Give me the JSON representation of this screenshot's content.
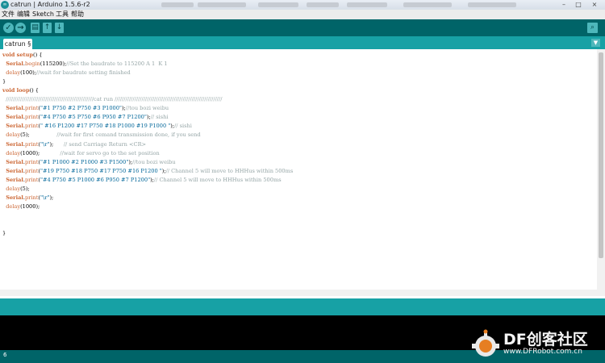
{
  "window": {
    "title": "catrun | Arduino 1.5.6-r2",
    "logo": "∞"
  },
  "menu": {
    "items": [
      "文件",
      "编辑",
      "Sketch",
      "工具",
      "帮助"
    ]
  },
  "toolbar": {
    "verify_icon": "✓",
    "upload_icon": "→",
    "new_icon": "▤",
    "open_icon": "↑",
    "save_icon": "↓",
    "serial_monitor_icon": "⌕"
  },
  "tabs": {
    "active_label": "catrun §",
    "menu_icon": "▼"
  },
  "code": {
    "lines": [
      [
        {
          "t": "void ",
          "c": "kw"
        },
        {
          "t": "setup",
          "c": "kw"
        },
        {
          "t": "() {",
          "c": ""
        }
      ],
      [
        {
          "t": "  ",
          "c": ""
        },
        {
          "t": "Serial",
          "c": "cl"
        },
        {
          "t": ".",
          "c": ""
        },
        {
          "t": "begin",
          "c": "fn"
        },
        {
          "t": "(115200);",
          "c": ""
        },
        {
          "t": "//Set the baudrate to 115200 A 1  K 1",
          "c": "cm"
        }
      ],
      [
        {
          "t": "  ",
          "c": ""
        },
        {
          "t": "delay",
          "c": "fn"
        },
        {
          "t": "(100);",
          "c": ""
        },
        {
          "t": "//wait for baudrate setting finished",
          "c": "cm"
        }
      ],
      [
        {
          "t": "}",
          "c": ""
        }
      ],
      [
        {
          "t": "void ",
          "c": "kw"
        },
        {
          "t": "loop",
          "c": "kw"
        },
        {
          "t": "() {",
          "c": ""
        }
      ],
      [
        {
          "t": "  ",
          "c": ""
        },
        {
          "t": "/////////////////////////////////////////////////cat run ////////////////////////////////////////////////////////////",
          "c": "cm"
        }
      ],
      [
        {
          "t": "  ",
          "c": ""
        },
        {
          "t": "Serial",
          "c": "cl"
        },
        {
          "t": ".",
          "c": ""
        },
        {
          "t": "print",
          "c": "fn"
        },
        {
          "t": "(",
          "c": ""
        },
        {
          "t": "\"#1 P750 #2 P750 #3 P1000\"",
          "c": "st"
        },
        {
          "t": ");",
          "c": ""
        },
        {
          "t": "//tou bozi weibu",
          "c": "cm"
        }
      ],
      [
        {
          "t": "  ",
          "c": ""
        },
        {
          "t": "Serial",
          "c": "cl"
        },
        {
          "t": ".",
          "c": ""
        },
        {
          "t": "print",
          "c": "fn"
        },
        {
          "t": "(",
          "c": ""
        },
        {
          "t": "\"#4 P750 #5 P750 #6 P950 #7 P1200\"",
          "c": "st"
        },
        {
          "t": ");",
          "c": ""
        },
        {
          "t": "// sishi",
          "c": "cm"
        }
      ],
      [
        {
          "t": "  ",
          "c": ""
        },
        {
          "t": "Serial",
          "c": "cl"
        },
        {
          "t": ".",
          "c": ""
        },
        {
          "t": "print",
          "c": "fn"
        },
        {
          "t": "(",
          "c": ""
        },
        {
          "t": "\" #16 P1200 #17 P750 #18 P1000 #19 P1000 \"",
          "c": "st"
        },
        {
          "t": ");",
          "c": ""
        },
        {
          "t": "// sishi",
          "c": "cm"
        }
      ],
      [
        {
          "t": "  ",
          "c": ""
        },
        {
          "t": "delay",
          "c": "fn"
        },
        {
          "t": "(5);                ",
          "c": ""
        },
        {
          "t": "//wait for first cemand transmission done, if you send",
          "c": "cm"
        }
      ],
      [
        {
          "t": "  ",
          "c": ""
        },
        {
          "t": "Serial",
          "c": "cl"
        },
        {
          "t": ".",
          "c": ""
        },
        {
          "t": "print",
          "c": "fn"
        },
        {
          "t": "(",
          "c": ""
        },
        {
          "t": "\"\\r\"",
          "c": "st"
        },
        {
          "t": ");      ",
          "c": ""
        },
        {
          "t": "// send Carriage Return <CR>",
          "c": "cm"
        }
      ],
      [
        {
          "t": "  ",
          "c": ""
        },
        {
          "t": "delay",
          "c": "fn"
        },
        {
          "t": "(1000);            ",
          "c": ""
        },
        {
          "t": "//wait for servo go to the set position",
          "c": "cm"
        }
      ],
      [
        {
          "t": "  ",
          "c": ""
        },
        {
          "t": "Serial",
          "c": "cl"
        },
        {
          "t": ".",
          "c": ""
        },
        {
          "t": "print",
          "c": "fn"
        },
        {
          "t": "(",
          "c": ""
        },
        {
          "t": "\"#1 P1000 #2 P1000 #3 P1500\"",
          "c": "st"
        },
        {
          "t": ");",
          "c": ""
        },
        {
          "t": "//tou bozi weibu",
          "c": "cm"
        }
      ],
      [
        {
          "t": "  ",
          "c": ""
        },
        {
          "t": "Serial",
          "c": "cl"
        },
        {
          "t": ".",
          "c": ""
        },
        {
          "t": "print",
          "c": "fn"
        },
        {
          "t": "(",
          "c": ""
        },
        {
          "t": "\"#19 P750 #18 P750 #17 P750 #16 P1200 \"",
          "c": "st"
        },
        {
          "t": ");",
          "c": ""
        },
        {
          "t": "// Channel 5 will move to HHHus within 500ms",
          "c": "cm"
        }
      ],
      [
        {
          "t": "  ",
          "c": ""
        },
        {
          "t": "Serial",
          "c": "cl"
        },
        {
          "t": ".",
          "c": ""
        },
        {
          "t": "print",
          "c": "fn"
        },
        {
          "t": "(",
          "c": ""
        },
        {
          "t": "\"#4 P750 #5 P1000 #6 P950 #7 P1200\"",
          "c": "st"
        },
        {
          "t": ");",
          "c": ""
        },
        {
          "t": "// Channel 5 will move to HHHus within 500ms",
          "c": "cm"
        }
      ],
      [
        {
          "t": "  ",
          "c": ""
        },
        {
          "t": "delay",
          "c": "fn"
        },
        {
          "t": "(5);",
          "c": ""
        }
      ],
      [
        {
          "t": "  ",
          "c": ""
        },
        {
          "t": "Serial",
          "c": "cl"
        },
        {
          "t": ".",
          "c": ""
        },
        {
          "t": "print",
          "c": "fn"
        },
        {
          "t": "(",
          "c": ""
        },
        {
          "t": "\"\\r\"",
          "c": "st"
        },
        {
          "t": ");",
          "c": ""
        }
      ],
      [
        {
          "t": "  ",
          "c": ""
        },
        {
          "t": "delay",
          "c": "fn"
        },
        {
          "t": "(1000);",
          "c": ""
        }
      ],
      [
        {
          "t": "",
          "c": ""
        }
      ],
      [
        {
          "t": "",
          "c": ""
        }
      ],
      [
        {
          "t": "}",
          "c": ""
        }
      ]
    ]
  },
  "status": {
    "line_number": "6"
  },
  "watermark": {
    "text": "DF创客社区",
    "url": "www.DFRobot.com.cn"
  },
  "colors": {
    "toolbar": "#006468",
    "tabbar": "#17a1a5",
    "button": "#4db7bb",
    "keyword": "#cc6633",
    "string": "#006699",
    "comment": "#95a5a6"
  }
}
